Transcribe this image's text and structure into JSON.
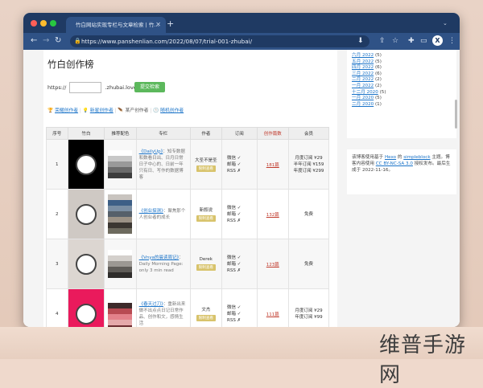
{
  "browser": {
    "tab_title": "竹白网站实现专栏与文章检索 | 竹…",
    "new_tab_label": "+",
    "url": "https://www.panshenlian.com/2022/08/07/trial-001-zhubai/",
    "profile_letter": "X",
    "nav": {
      "back": "←",
      "forward": "→",
      "reload": "↻"
    },
    "icons": [
      "download-icon",
      "share-icon",
      "star-icon",
      "extensions-icon",
      "sidebar-icon",
      "profile-icon",
      "menu-icon"
    ]
  },
  "page": {
    "title": "竹白创作榜",
    "url_prefix": "https://",
    "url_suffix": ".zhubai.love/",
    "submit_label": "提交检索",
    "links": [
      {
        "icon": "trophy-icon",
        "label": "荣耀创作者"
      },
      {
        "icon": "lightbulb-icon",
        "label": "新星创作者"
      },
      {
        "icon": "feather-icon",
        "label": "某产创作者"
      },
      {
        "icon": "clock-icon",
        "label": "随机创作者"
      }
    ],
    "table": {
      "headers": [
        "序号",
        "竹白",
        "推荐配色",
        "专栏",
        "作者",
        "订阅",
        "创作篇数",
        "会员"
      ],
      "rows": [
        {
          "index": "1",
          "avatar_bg": "#000000",
          "palette": [
            "#ffffff",
            "#c8c8c8",
            "#9a9a9a",
            "#6b6b6b",
            "#3d3d3d"
          ],
          "col_title": "《DailyUp》",
          "col_desc": "：知专数据和数看日出、日月日常日子中心的、日前一年只有日、写作的数据博客",
          "author": "大圣不是圣",
          "author_tag": "限制查看",
          "subs": [
            "微信 ✓",
            "邮箱 ✓",
            "RSS ✗"
          ],
          "count": "181篇",
          "member": "月度订阅 ¥29\n半年订阅 ¥159\n年度订阅 ¥299"
        },
        {
          "index": "2",
          "avatar_bg": "#cfc9c4",
          "palette": [
            "#c9c4bf",
            "#3d5f86",
            "#7a8ea3",
            "#56606a",
            "#9c9286",
            "#3c3732",
            "#6d6a5e"
          ],
          "col_title": "《创业探测》",
          "col_desc": "：聚焦那个人创业者的成长",
          "author": "新叙说",
          "author_tag": "限制查看",
          "subs": [
            "微信 ✓",
            "邮箱 ✓",
            "RSS ✗"
          ],
          "count": "132篇",
          "member": "免费"
        },
        {
          "index": "3",
          "avatar_bg": "#dcd6d1",
          "palette": [
            "#ffffff",
            "#d4d0cc",
            "#9c9893",
            "#5f5c58",
            "#2f2d2b"
          ],
          "col_title": "《Vnya的晨读周记》",
          "col_desc": "：Daily Morning Page: only 3 min read",
          "author": "Derek",
          "author_tag": "限制查看",
          "subs": [
            "微信 ✓",
            "邮箱 ✓",
            "RSS ✗"
          ],
          "count": "123篇",
          "member": "免费"
        },
        {
          "index": "4",
          "avatar_bg": "#ea1a5c",
          "palette": [
            "#ffffff",
            "#3d2a2a",
            "#b84a52",
            "#e3818a",
            "#e5a9aa",
            "#6b2c30"
          ],
          "col_title": "《春天过刀》",
          "col_desc": "：重新出来做不出点点日记日常作品、创作和文，感情生活",
          "author": "文杰",
          "author_tag": "限制查看",
          "subs": [
            "微信 ✓",
            "邮箱 ✓",
            "RSS ✗"
          ],
          "count": "111篇",
          "member": "月度订阅 ¥29\n年度订阅 ¥99"
        }
      ]
    }
  },
  "sidebar": {
    "archive": [
      {
        "label": "六月 2022",
        "count": "(5)"
      },
      {
        "label": "五月 2022",
        "count": "(5)"
      },
      {
        "label": "四月 2022",
        "count": "(6)"
      },
      {
        "label": "三月 2022",
        "count": "(6)"
      },
      {
        "label": "二月 2022",
        "count": "(2)"
      },
      {
        "label": "一月 2022",
        "count": "(2)"
      },
      {
        "label": "十二月 2020",
        "count": "(5)"
      },
      {
        "label": "一月 2020",
        "count": "(5)"
      },
      {
        "label": "二月 2020",
        "count": "(1)"
      }
    ],
    "note": {
      "line1_pre": "该博客使用基于",
      "hexo": "Hexo",
      "line1_post": "的",
      "theme": "simpleblock",
      "line2": "主题。博客内容使用",
      "license": "CC BY-NC-SA 3.0",
      "line3": "授权发布。最后生成于 2022-11-16。"
    }
  },
  "watermark": "维普手游网",
  "colors": {
    "titlebar": "#1f3a63",
    "toolbar": "#2f5286",
    "link": "#1a73c8",
    "submit": "#5cb85c",
    "accent_red": "#c0392b"
  }
}
